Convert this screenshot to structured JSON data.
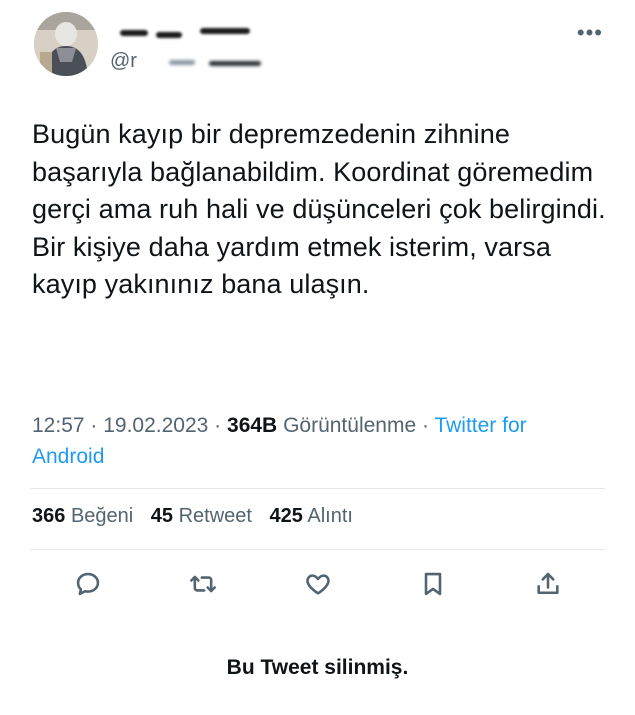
{
  "tweet": {
    "handle_prefix": "@r",
    "text": "Bugün kayıp bir depremzedenin zihnine başarıyla bağlanabildim. Koordinat göremedim gerçi ama ruh hali ve düşünceleri çok belirgindi. Bir kişiye daha yardım etmek isterim, varsa kayıp yakınınız bana ulaşın.",
    "time": "12:57",
    "date": "19.02.2023",
    "views_count": "364B",
    "views_label": "Görüntülenme",
    "source_line1": "Twitter for",
    "source_line2": "Android"
  },
  "stats": {
    "likes_count": "366",
    "likes_label": "Beğeni",
    "retweets_count": "45",
    "retweets_label": "Retweet",
    "quotes_count": "425",
    "quotes_label": "Alıntı"
  },
  "actions": [
    "reply-icon",
    "retweet-icon",
    "like-icon",
    "bookmark-icon",
    "share-icon"
  ],
  "colors": {
    "link": "#1d9bf0",
    "secondary": "#536471",
    "text": "#0f1419"
  },
  "footer": {
    "deleted_notice": "Bu Tweet silinmiş."
  }
}
